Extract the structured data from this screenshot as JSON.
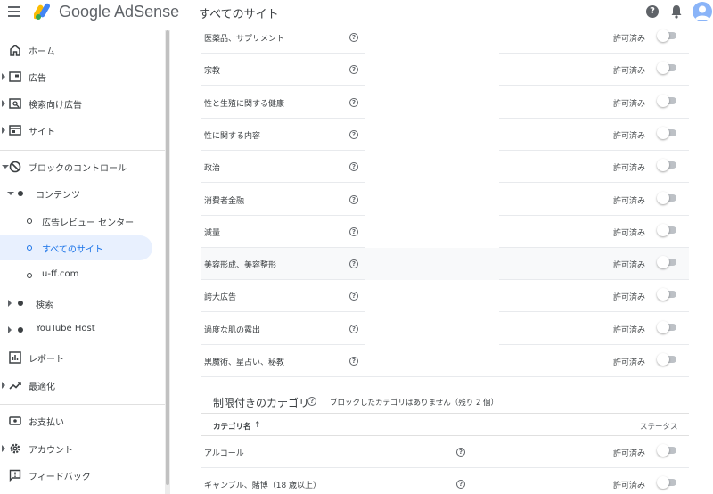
{
  "header": {
    "brand": "Google AdSense",
    "title": "すべてのサイト",
    "help_symbol": "?"
  },
  "sidebar": {
    "items": [
      {
        "label": "ホーム",
        "icon": "home-icon"
      },
      {
        "label": "広告",
        "icon": "ads-icon"
      },
      {
        "label": "検索向け広告",
        "icon": "search-ads-icon"
      },
      {
        "label": "サイト",
        "icon": "sites-icon"
      },
      {
        "label": "ブロックのコントロール",
        "icon": "block-icon"
      },
      {
        "label": "コンテンツ",
        "icon": "dot-icon"
      },
      {
        "label": "広告レビュー センター",
        "icon": "ring-icon"
      },
      {
        "label": "すべてのサイト",
        "icon": "ring-icon",
        "active": true
      },
      {
        "label": "u-ff.com",
        "icon": "ring-icon"
      },
      {
        "label": "検索",
        "icon": "dot-icon"
      },
      {
        "label": "YouTube Host",
        "icon": "dot-icon"
      },
      {
        "label": "レポート",
        "icon": "reports-icon"
      },
      {
        "label": "最適化",
        "icon": "optimize-icon"
      },
      {
        "label": "お支払い",
        "icon": "payments-icon"
      },
      {
        "label": "アカウント",
        "icon": "gear-icon"
      },
      {
        "label": "フィードバック",
        "icon": "feedback-icon"
      }
    ]
  },
  "categories": [
    {
      "name": "医薬品、サプリメント",
      "status": "許可済み"
    },
    {
      "name": "宗教",
      "status": "許可済み"
    },
    {
      "name": "性と生殖に関する健康",
      "status": "許可済み"
    },
    {
      "name": "性に関する内容",
      "status": "許可済み"
    },
    {
      "name": "政治",
      "status": "許可済み"
    },
    {
      "name": "消費者金融",
      "status": "許可済み"
    },
    {
      "name": "減量",
      "status": "許可済み"
    },
    {
      "name": "美容形成、美容整形",
      "status": "許可済み"
    },
    {
      "name": "誇大広告",
      "status": "許可済み"
    },
    {
      "name": "過度な肌の露出",
      "status": "許可済み"
    },
    {
      "name": "黒魔術、星占い、秘教",
      "status": "許可済み"
    }
  ],
  "restricted": {
    "title": "制限付きのカテゴリ",
    "note": "ブロックしたカテゴリはありません（残り 2 個）",
    "col_name": "カテゴリ名",
    "sort_arrow": "↑",
    "col_status": "ステータス",
    "items": [
      {
        "name": "アルコール",
        "status": "許可済み"
      },
      {
        "name": "ギャンブル、賭博（18 歳以上）",
        "status": "許可済み"
      }
    ]
  },
  "colors": {
    "accent": "#1a73e8",
    "active_bg": "#e8f0fe",
    "text": "#3c4043",
    "toggle_off": "#bdc1c6"
  }
}
